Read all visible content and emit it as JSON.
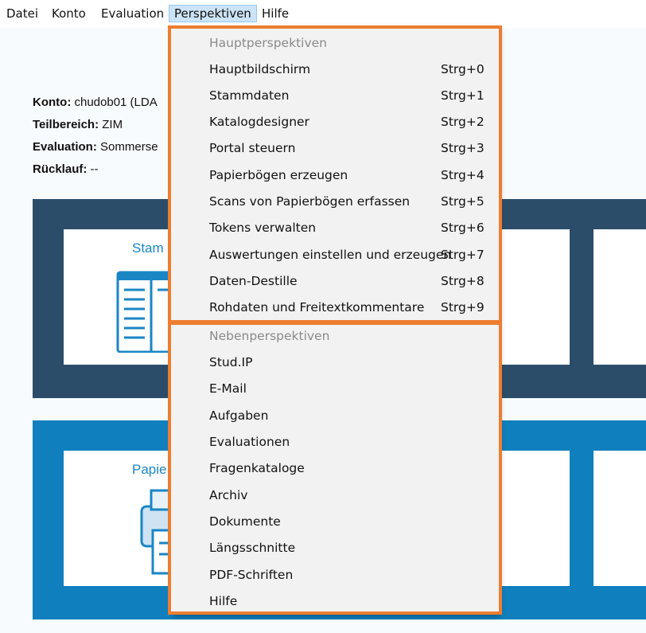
{
  "menubar": {
    "items": [
      {
        "label": "Datei"
      },
      {
        "label": "Konto"
      },
      {
        "label": "Evaluation"
      },
      {
        "label": "Perspektiven"
      },
      {
        "label": "Hilfe"
      }
    ]
  },
  "info": {
    "konto_label": "Konto:",
    "konto_value": " chudob01 (LDA",
    "teilbereich_label": "Teilbereich:",
    "teilbereich_value": " ZIM",
    "evaluation_label": "Evaluation:",
    "evaluation_value": " Sommerse",
    "ruecklauf_label": "Rücklauf:",
    "ruecklauf_value": " --"
  },
  "tiles": {
    "stammdaten_title": "Stam",
    "papier_title": "Papie"
  },
  "dropdown": {
    "main_header": "Hauptperspektiven",
    "main_items": [
      {
        "label": "Hauptbildschirm",
        "shortcut": "Strg+0"
      },
      {
        "label": "Stammdaten",
        "shortcut": "Strg+1"
      },
      {
        "label": "Katalogdesigner",
        "shortcut": "Strg+2"
      },
      {
        "label": "Portal steuern",
        "shortcut": "Strg+3"
      },
      {
        "label": "Papierbögen erzeugen",
        "shortcut": "Strg+4"
      },
      {
        "label": "Scans von Papierbögen erfassen",
        "shortcut": "Strg+5"
      },
      {
        "label": "Tokens verwalten",
        "shortcut": "Strg+6"
      },
      {
        "label": "Auswertungen einstellen und erzeugen",
        "shortcut": "Strg+7"
      },
      {
        "label": "Daten-Destille",
        "shortcut": "Strg+8"
      },
      {
        "label": "Rohdaten und Freitextkommentare",
        "shortcut": "Strg+9"
      }
    ],
    "sub_header": "Nebenperspektiven",
    "sub_items": [
      {
        "label": "Stud.IP"
      },
      {
        "label": "E-Mail"
      },
      {
        "label": "Aufgaben"
      },
      {
        "label": "Evaluationen"
      },
      {
        "label": "Fragenkataloge"
      },
      {
        "label": "Archiv"
      },
      {
        "label": "Dokumente"
      },
      {
        "label": "Längsschnitte"
      },
      {
        "label": "PDF-Schriften"
      },
      {
        "label": "Hilfe"
      }
    ]
  },
  "colors": {
    "highlight_border": "#ee7d30",
    "dark_band": "#2c4d69",
    "blue_band": "#0f7fbd",
    "tile_title": "#1a86c4"
  },
  "icons": [
    "document-list-icon",
    "question-marks-icon",
    "printer-icon"
  ]
}
